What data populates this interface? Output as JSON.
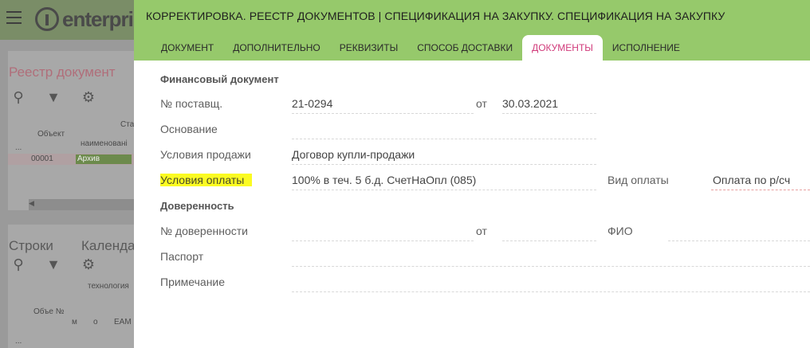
{
  "background": {
    "logo_text": "enterpri",
    "panel1": {
      "title": "Реестр документ",
      "col_object": "Объект",
      "col_status": "Ста",
      "col_name": "наименовані",
      "ellipsis": "...",
      "row_id": "00001",
      "row_status": "Архив"
    },
    "panel2": {
      "title_rows": "Строки",
      "title_calendar": "Календа",
      "col_technology": "технология",
      "col_object": "Объе №",
      "col_m": "м",
      "col_o": "о",
      "col_eam": "EAM",
      "ellipsis": "..."
    }
  },
  "dialog": {
    "title": "КОРРЕКТИРОВКА. РЕЕСТР ДОКУМЕНТОВ | СПЕЦИФИКАЦИЯ НА ЗАКУПКУ. СПЕЦИФИКАЦИЯ НА ЗАКУПКУ",
    "tabs": [
      {
        "label": "ДОКУМЕНТ"
      },
      {
        "label": "ДОПОЛНИТЕЛЬНО"
      },
      {
        "label": "РЕКВИЗИТЫ"
      },
      {
        "label": "СПОСОБ ДОСТАВКИ"
      },
      {
        "label": "ДОКУМЕНТЫ"
      },
      {
        "label": "ИСПОЛНЕНИЕ"
      }
    ],
    "active_tab": "ДОКУМЕНТЫ",
    "financial_section": "Финансовый документ",
    "supplier_no_label": "№ поставщ.",
    "supplier_no_value": "21-0294",
    "from_label": "от",
    "supplier_date": "30.03.2021",
    "basis_label": "Основание",
    "basis_value": "",
    "sale_terms_label": "Условия продажи",
    "sale_terms_value": "Договор купли-продажи",
    "payment_terms_label": "Условия оплаты",
    "payment_terms_value": "100% в теч. 5 б.д. СчетНаОпл (085)",
    "payment_type_label": "Вид оплаты",
    "payment_type_value": "Оплата по р/сч",
    "proxy_section": "Доверенность",
    "proxy_no_label": "№ доверенности",
    "proxy_no_value": "",
    "proxy_from_label": "от",
    "proxy_date": "",
    "fio_label": "ФИО",
    "fio_value": "",
    "passport_label": "Паспорт",
    "passport_value": "",
    "note_label": "Примечание",
    "note_value": ""
  },
  "colors": {
    "header_green": "#96c96b",
    "active_tab_text": "#d13a7a",
    "highlight": "#fbfb22"
  }
}
